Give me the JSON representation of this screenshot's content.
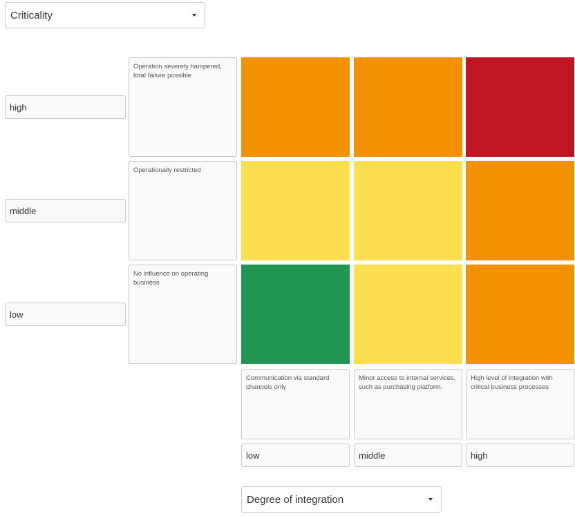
{
  "criticality_select": {
    "value": "Criticality"
  },
  "integration_select": {
    "value": "Degree of integration"
  },
  "rows": [
    {
      "label": "high",
      "description": "Operation severely hampered, total failure possible"
    },
    {
      "label": "middle",
      "description": "Operationally restricted"
    },
    {
      "label": "low",
      "description": "No influence on operating business"
    }
  ],
  "columns": [
    {
      "label": "low",
      "description": "Communication via standard channels only"
    },
    {
      "label": "middle",
      "description": "Minor access to internal services, such as purchasing platform."
    },
    {
      "label": "high",
      "description": "High level of integration with critical business processes"
    }
  ],
  "colors": {
    "green": "#219653",
    "yellow": "#fde04f",
    "orange": "#f39200",
    "red": "#be1622"
  },
  "matrix": [
    [
      "orange",
      "orange",
      "red"
    ],
    [
      "yellow",
      "yellow",
      "orange"
    ],
    [
      "green",
      "yellow",
      "orange"
    ]
  ]
}
